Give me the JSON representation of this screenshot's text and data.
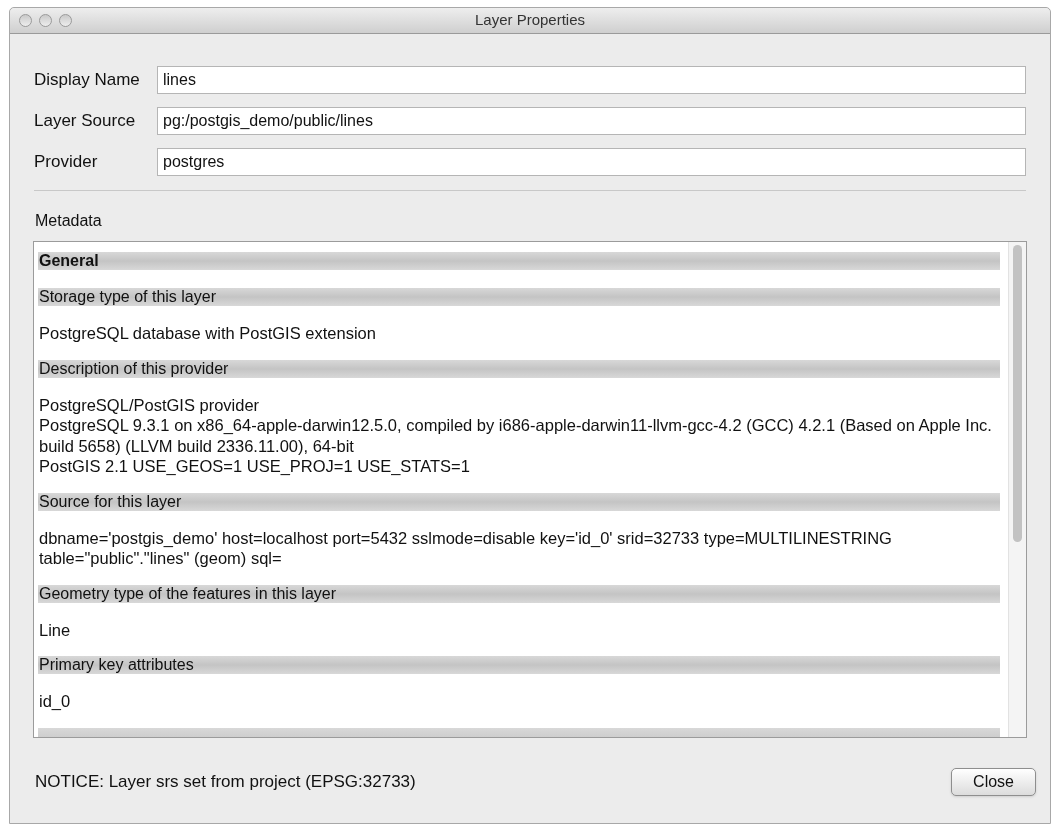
{
  "window": {
    "title": "Layer Properties"
  },
  "fields": [
    {
      "label": "Display Name",
      "value": "lines"
    },
    {
      "label": "Layer Source",
      "value": "pg:/postgis_demo/public/lines"
    },
    {
      "label": "Provider",
      "value": "postgres"
    }
  ],
  "metadata": {
    "label": "Metadata",
    "sections": [
      {
        "heading": "General",
        "bold": true
      },
      {
        "heading": "Storage type of this layer",
        "bold": false,
        "lines": [
          "PostgreSQL database with PostGIS extension"
        ]
      },
      {
        "heading": "Description of this provider",
        "bold": false,
        "lines": [
          "PostgreSQL/PostGIS provider",
          "PostgreSQL 9.3.1 on x86_64-apple-darwin12.5.0, compiled by i686-apple-darwin11-llvm-gcc-4.2 (GCC) 4.2.1 (Based on Apple Inc. build 5658) (LLVM build 2336.11.00), 64-bit",
          "PostGIS 2.1 USE_GEOS=1 USE_PROJ=1 USE_STATS=1"
        ]
      },
      {
        "heading": "Source for this layer",
        "bold": false,
        "lines": [
          "dbname='postgis_demo' host=localhost port=5432 sslmode=disable key='id_0' srid=32733 type=MULTILINESTRING table=\"public\".\"lines\" (geom) sql="
        ]
      },
      {
        "heading": "Geometry type of the features in this layer",
        "bold": false,
        "lines": [
          "Line"
        ]
      },
      {
        "heading": "Primary key attributes",
        "bold": false,
        "lines": [
          "id_0"
        ]
      }
    ]
  },
  "notice": "NOTICE: Layer srs set from project (EPSG:32733)",
  "buttons": [
    "Close"
  ]
}
